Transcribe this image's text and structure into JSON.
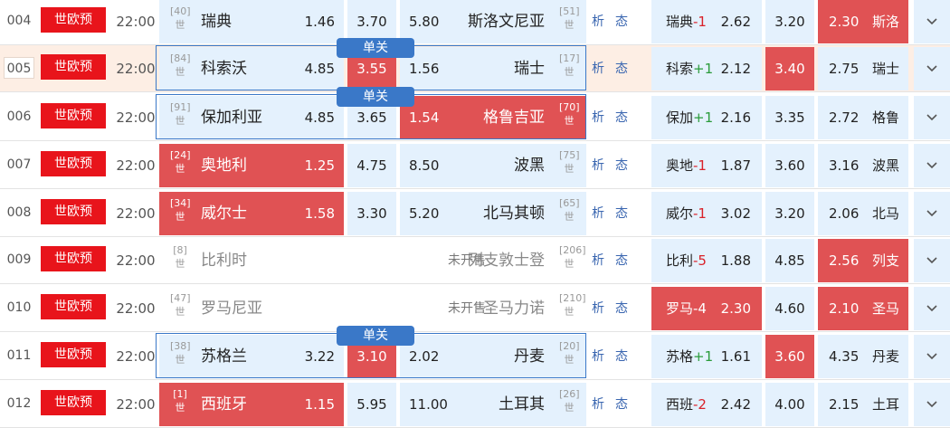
{
  "rows": [
    {
      "num": "004",
      "league": "世欧预",
      "time": "22:00",
      "home": {
        "rank": "40",
        "zone": "世",
        "name": "瑞典"
      },
      "odds_home": "1.46",
      "odds_draw": "3.70",
      "odds_away": "5.80",
      "away": {
        "rank": "51",
        "zone": "世",
        "name": "斯洛文尼亚"
      },
      "analysis": "析",
      "status": "态",
      "hc_team": "瑞典",
      "hc_value": "-1",
      "hc_home": "2.62",
      "hc_draw": "3.20",
      "hc_away": "2.30",
      "hc_away_team": "斯洛",
      "presale": "",
      "danguan": ""
    },
    {
      "num": "005",
      "league": "世欧预",
      "time": "22:00",
      "home": {
        "rank": "84",
        "zone": "世",
        "name": "科索沃"
      },
      "odds_home": "4.85",
      "odds_draw": "3.55",
      "odds_away": "1.56",
      "away": {
        "rank": "17",
        "zone": "世",
        "name": "瑞士"
      },
      "analysis": "析",
      "status": "态",
      "hc_team": "科索",
      "hc_value": "+1",
      "hc_home": "2.12",
      "hc_draw": "3.40",
      "hc_away": "2.75",
      "hc_away_team": "瑞士",
      "presale": "",
      "danguan": "单关"
    },
    {
      "num": "006",
      "league": "世欧预",
      "time": "22:00",
      "home": {
        "rank": "91",
        "zone": "世",
        "name": "保加利亚"
      },
      "odds_home": "4.85",
      "odds_draw": "3.65",
      "odds_away": "1.54",
      "away": {
        "rank": "70",
        "zone": "世",
        "name": "格鲁吉亚"
      },
      "analysis": "析",
      "status": "态",
      "hc_team": "保加",
      "hc_value": "+1",
      "hc_home": "2.16",
      "hc_draw": "3.35",
      "hc_away": "2.72",
      "hc_away_team": "格鲁",
      "presale": "",
      "danguan": "单关"
    },
    {
      "num": "007",
      "league": "世欧预",
      "time": "22:00",
      "home": {
        "rank": "24",
        "zone": "世",
        "name": "奥地利"
      },
      "odds_home": "1.25",
      "odds_draw": "4.75",
      "odds_away": "8.50",
      "away": {
        "rank": "75",
        "zone": "世",
        "name": "波黑"
      },
      "analysis": "析",
      "status": "态",
      "hc_team": "奥地",
      "hc_value": "-1",
      "hc_home": "1.87",
      "hc_draw": "3.60",
      "hc_away": "3.16",
      "hc_away_team": "波黑",
      "presale": "",
      "danguan": ""
    },
    {
      "num": "008",
      "league": "世欧预",
      "time": "22:00",
      "home": {
        "rank": "34",
        "zone": "世",
        "name": "威尔士"
      },
      "odds_home": "1.58",
      "odds_draw": "3.30",
      "odds_away": "5.20",
      "away": {
        "rank": "65",
        "zone": "世",
        "name": "北马其顿"
      },
      "analysis": "析",
      "status": "态",
      "hc_team": "威尔",
      "hc_value": "-1",
      "hc_home": "3.02",
      "hc_draw": "3.20",
      "hc_away": "2.06",
      "hc_away_team": "北马",
      "presale": "",
      "danguan": ""
    },
    {
      "num": "009",
      "league": "世欧预",
      "time": "22:00",
      "home": {
        "rank": "8",
        "zone": "世",
        "name": "比利时"
      },
      "odds_home": "",
      "odds_draw": "",
      "odds_away": "",
      "away": {
        "rank": "206",
        "zone": "世",
        "name": "列支敦士登"
      },
      "analysis": "析",
      "status": "态",
      "hc_team": "比利",
      "hc_value": "-5",
      "hc_home": "1.88",
      "hc_draw": "4.85",
      "hc_away": "2.56",
      "hc_away_team": "列支",
      "presale": "未开售",
      "danguan": ""
    },
    {
      "num": "010",
      "league": "世欧预",
      "time": "22:00",
      "home": {
        "rank": "47",
        "zone": "世",
        "name": "罗马尼亚"
      },
      "odds_home": "",
      "odds_draw": "",
      "odds_away": "",
      "away": {
        "rank": "210",
        "zone": "世",
        "name": "圣马力诺"
      },
      "analysis": "析",
      "status": "态",
      "hc_team": "罗马",
      "hc_value": "-4",
      "hc_home": "2.30",
      "hc_draw": "4.60",
      "hc_away": "2.10",
      "hc_away_team": "圣马",
      "presale": "未开售",
      "danguan": ""
    },
    {
      "num": "011",
      "league": "世欧预",
      "time": "22:00",
      "home": {
        "rank": "38",
        "zone": "世",
        "name": "苏格兰"
      },
      "odds_home": "3.22",
      "odds_draw": "3.10",
      "odds_away": "2.02",
      "away": {
        "rank": "20",
        "zone": "世",
        "name": "丹麦"
      },
      "analysis": "析",
      "status": "态",
      "hc_team": "苏格",
      "hc_value": "+1",
      "hc_home": "1.61",
      "hc_draw": "3.60",
      "hc_away": "4.35",
      "hc_away_team": "丹麦",
      "presale": "",
      "danguan": "单关"
    },
    {
      "num": "012",
      "league": "世欧预",
      "time": "22:00",
      "home": {
        "rank": "1",
        "zone": "世",
        "name": "西班牙"
      },
      "odds_home": "1.15",
      "odds_draw": "5.95",
      "odds_away": "11.00",
      "away": {
        "rank": "26",
        "zone": "世",
        "name": "土耳其"
      },
      "analysis": "析",
      "status": "态",
      "hc_team": "西班",
      "hc_value": "-2",
      "hc_home": "2.42",
      "hc_draw": "4.00",
      "hc_away": "2.15",
      "hc_away_team": "土耳",
      "presale": "",
      "danguan": ""
    }
  ],
  "colors": {
    "accent_red": "#e05254",
    "league_red": "#e8141b",
    "cell_blue": "#e4f1fd",
    "select_blue": "#3a78c8",
    "highlight": "#fdeee4"
  }
}
